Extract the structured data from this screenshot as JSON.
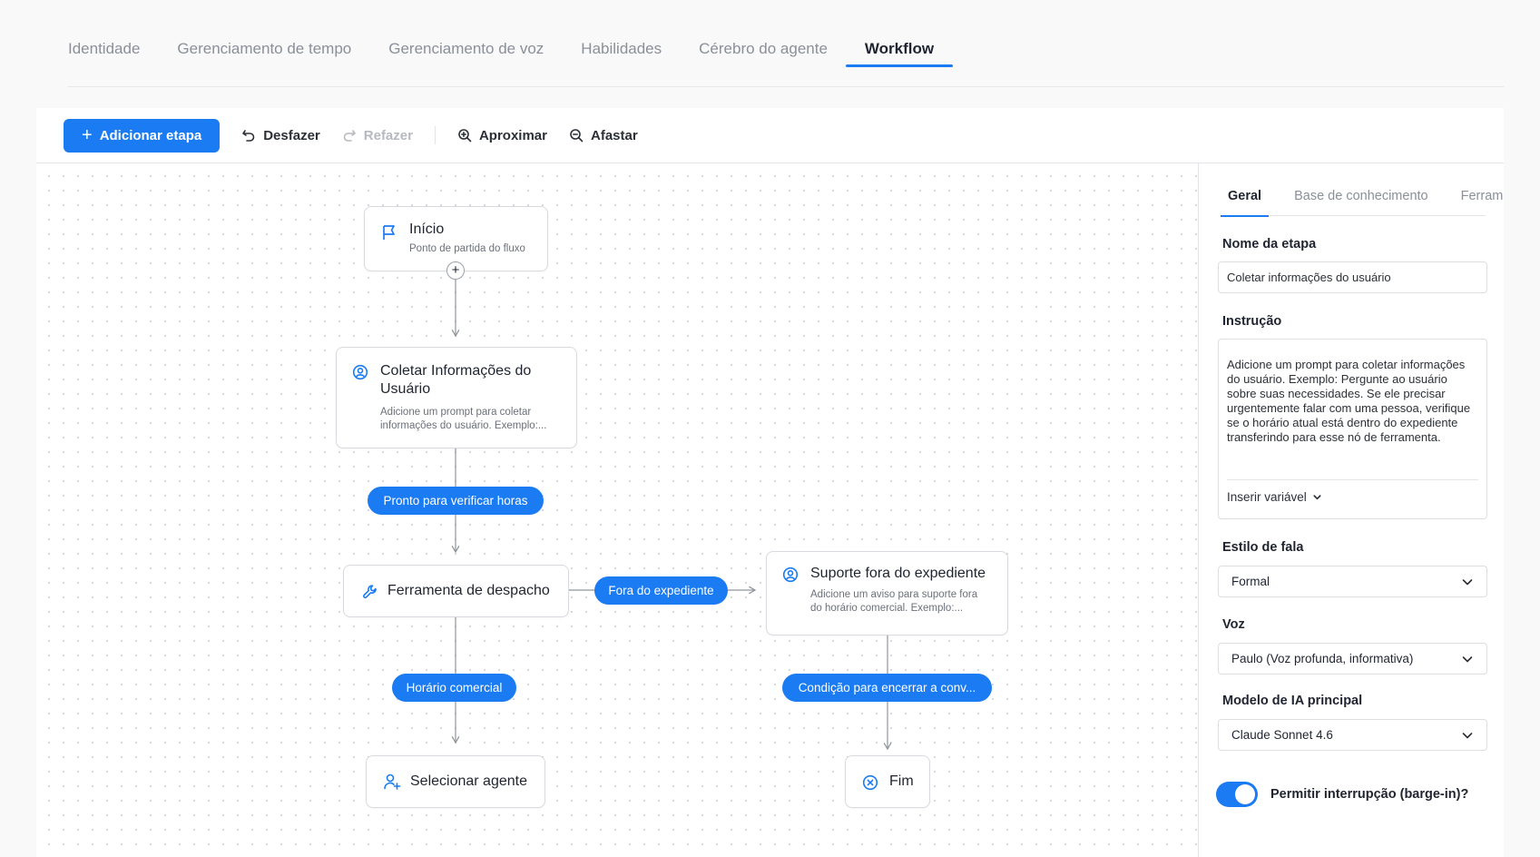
{
  "tabs": [
    {
      "label": "Identidade"
    },
    {
      "label": "Gerenciamento de tempo"
    },
    {
      "label": "Gerenciamento de voz"
    },
    {
      "label": "Habilidades"
    },
    {
      "label": "Cérebro do agente"
    },
    {
      "label": "Workflow",
      "active": true
    }
  ],
  "toolbar": {
    "add_step": "Adicionar etapa",
    "undo": "Desfazer",
    "redo": "Refazer",
    "zoom_in": "Aproximar",
    "zoom_out": "Afastar"
  },
  "nodes": {
    "inicio": {
      "title": "Início",
      "desc": "Ponto de partida do fluxo",
      "icon": "flag-icon"
    },
    "coletar": {
      "title": "Coletar Informações do Usuário",
      "desc": "Adicione um prompt para coletar informações do usuário. Exemplo:...",
      "icon": "user-circle-icon"
    },
    "ferramenta": {
      "title": "Ferramenta de despacho",
      "icon": "wrench-icon"
    },
    "suporte": {
      "title": "Suporte fora do expediente",
      "desc": "Adicione um aviso para suporte fora do horário comercial. Exemplo:...",
      "icon": "user-circle-icon"
    },
    "selecionar": {
      "title": "Selecionar agente",
      "icon": "user-plus-icon"
    },
    "fim": {
      "title": "Fim",
      "icon": "x-circle-icon"
    }
  },
  "edges": {
    "pronto": "Pronto para verificar horas",
    "fora": "Fora do expediente",
    "horario": "Horário comercial",
    "condicao": "Condição para encerrar a conv..."
  },
  "panel": {
    "tabs": [
      "Geral",
      "Base de conhecimento",
      "Ferramer"
    ],
    "step_name_label": "Nome da etapa",
    "step_name_value": "Coletar informações do usuário",
    "instruction_label": "Instrução",
    "instruction_value": "Adicione um prompt para coletar informações do usuário. Exemplo: Pergunte ao usuário sobre suas necessidades. Se ele precisar urgentemente falar com uma pessoa, verifique se o horário atual está dentro do expediente transferindo para esse nó de ferramenta.",
    "insert_variable": "Inserir variável",
    "speech_style_label": "Estilo de fala",
    "speech_style_value": "Formal",
    "voice_label": "Voz",
    "voice_value": "Paulo (Voz profunda, informativa)",
    "model_label": "Modelo de IA principal",
    "model_value": "Claude Sonnet 4.6",
    "barge_in_label": "Permitir interrupção (barge-in)?",
    "barge_in_enabled": true
  },
  "colors": {
    "accent": "#1a7bf2"
  }
}
